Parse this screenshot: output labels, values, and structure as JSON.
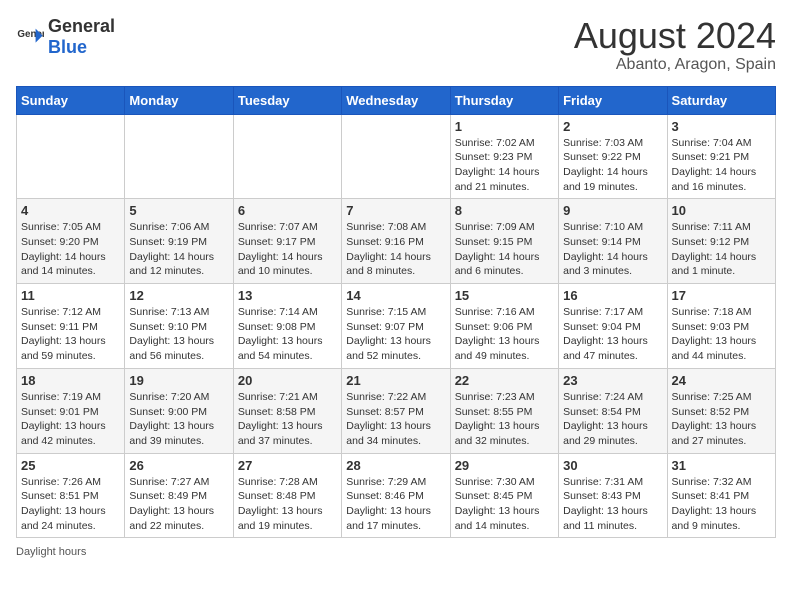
{
  "header": {
    "logo_general": "General",
    "logo_blue": "Blue",
    "main_title": "August 2024",
    "subtitle": "Abanto, Aragon, Spain"
  },
  "days_of_week": [
    "Sunday",
    "Monday",
    "Tuesday",
    "Wednesday",
    "Thursday",
    "Friday",
    "Saturday"
  ],
  "footer": {
    "daylight_label": "Daylight hours"
  },
  "weeks": [
    {
      "days": [
        {
          "number": "",
          "info": ""
        },
        {
          "number": "",
          "info": ""
        },
        {
          "number": "",
          "info": ""
        },
        {
          "number": "",
          "info": ""
        },
        {
          "number": "1",
          "info": "Sunrise: 7:02 AM\nSunset: 9:23 PM\nDaylight: 14 hours and 21 minutes."
        },
        {
          "number": "2",
          "info": "Sunrise: 7:03 AM\nSunset: 9:22 PM\nDaylight: 14 hours and 19 minutes."
        },
        {
          "number": "3",
          "info": "Sunrise: 7:04 AM\nSunset: 9:21 PM\nDaylight: 14 hours and 16 minutes."
        }
      ]
    },
    {
      "days": [
        {
          "number": "4",
          "info": "Sunrise: 7:05 AM\nSunset: 9:20 PM\nDaylight: 14 hours and 14 minutes."
        },
        {
          "number": "5",
          "info": "Sunrise: 7:06 AM\nSunset: 9:19 PM\nDaylight: 14 hours and 12 minutes."
        },
        {
          "number": "6",
          "info": "Sunrise: 7:07 AM\nSunset: 9:17 PM\nDaylight: 14 hours and 10 minutes."
        },
        {
          "number": "7",
          "info": "Sunrise: 7:08 AM\nSunset: 9:16 PM\nDaylight: 14 hours and 8 minutes."
        },
        {
          "number": "8",
          "info": "Sunrise: 7:09 AM\nSunset: 9:15 PM\nDaylight: 14 hours and 6 minutes."
        },
        {
          "number": "9",
          "info": "Sunrise: 7:10 AM\nSunset: 9:14 PM\nDaylight: 14 hours and 3 minutes."
        },
        {
          "number": "10",
          "info": "Sunrise: 7:11 AM\nSunset: 9:12 PM\nDaylight: 14 hours and 1 minute."
        }
      ]
    },
    {
      "days": [
        {
          "number": "11",
          "info": "Sunrise: 7:12 AM\nSunset: 9:11 PM\nDaylight: 13 hours and 59 minutes."
        },
        {
          "number": "12",
          "info": "Sunrise: 7:13 AM\nSunset: 9:10 PM\nDaylight: 13 hours and 56 minutes."
        },
        {
          "number": "13",
          "info": "Sunrise: 7:14 AM\nSunset: 9:08 PM\nDaylight: 13 hours and 54 minutes."
        },
        {
          "number": "14",
          "info": "Sunrise: 7:15 AM\nSunset: 9:07 PM\nDaylight: 13 hours and 52 minutes."
        },
        {
          "number": "15",
          "info": "Sunrise: 7:16 AM\nSunset: 9:06 PM\nDaylight: 13 hours and 49 minutes."
        },
        {
          "number": "16",
          "info": "Sunrise: 7:17 AM\nSunset: 9:04 PM\nDaylight: 13 hours and 47 minutes."
        },
        {
          "number": "17",
          "info": "Sunrise: 7:18 AM\nSunset: 9:03 PM\nDaylight: 13 hours and 44 minutes."
        }
      ]
    },
    {
      "days": [
        {
          "number": "18",
          "info": "Sunrise: 7:19 AM\nSunset: 9:01 PM\nDaylight: 13 hours and 42 minutes."
        },
        {
          "number": "19",
          "info": "Sunrise: 7:20 AM\nSunset: 9:00 PM\nDaylight: 13 hours and 39 minutes."
        },
        {
          "number": "20",
          "info": "Sunrise: 7:21 AM\nSunset: 8:58 PM\nDaylight: 13 hours and 37 minutes."
        },
        {
          "number": "21",
          "info": "Sunrise: 7:22 AM\nSunset: 8:57 PM\nDaylight: 13 hours and 34 minutes."
        },
        {
          "number": "22",
          "info": "Sunrise: 7:23 AM\nSunset: 8:55 PM\nDaylight: 13 hours and 32 minutes."
        },
        {
          "number": "23",
          "info": "Sunrise: 7:24 AM\nSunset: 8:54 PM\nDaylight: 13 hours and 29 minutes."
        },
        {
          "number": "24",
          "info": "Sunrise: 7:25 AM\nSunset: 8:52 PM\nDaylight: 13 hours and 27 minutes."
        }
      ]
    },
    {
      "days": [
        {
          "number": "25",
          "info": "Sunrise: 7:26 AM\nSunset: 8:51 PM\nDaylight: 13 hours and 24 minutes."
        },
        {
          "number": "26",
          "info": "Sunrise: 7:27 AM\nSunset: 8:49 PM\nDaylight: 13 hours and 22 minutes."
        },
        {
          "number": "27",
          "info": "Sunrise: 7:28 AM\nSunset: 8:48 PM\nDaylight: 13 hours and 19 minutes."
        },
        {
          "number": "28",
          "info": "Sunrise: 7:29 AM\nSunset: 8:46 PM\nDaylight: 13 hours and 17 minutes."
        },
        {
          "number": "29",
          "info": "Sunrise: 7:30 AM\nSunset: 8:45 PM\nDaylight: 13 hours and 14 minutes."
        },
        {
          "number": "30",
          "info": "Sunrise: 7:31 AM\nSunset: 8:43 PM\nDaylight: 13 hours and 11 minutes."
        },
        {
          "number": "31",
          "info": "Sunrise: 7:32 AM\nSunset: 8:41 PM\nDaylight: 13 hours and 9 minutes."
        }
      ]
    }
  ]
}
